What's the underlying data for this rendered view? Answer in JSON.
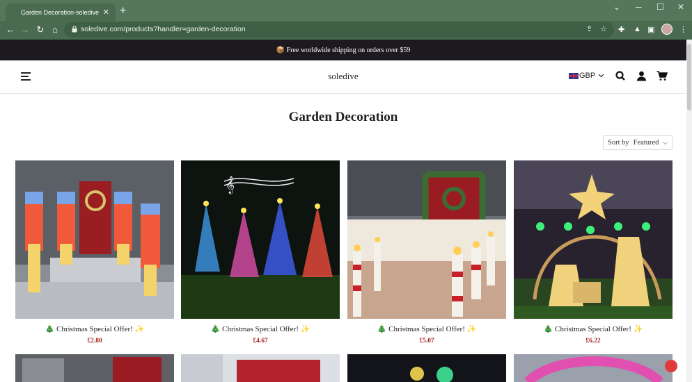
{
  "browser": {
    "tab_title": "Garden Decoration-soledive",
    "tab_close": "✕",
    "new_tab": "+",
    "url": "soledive.com/products?handler=garden-decoration"
  },
  "announcement": "📦 Free worldwide shipping on orders over $59",
  "header": {
    "brand": "soledive",
    "currency": "GBP"
  },
  "page": {
    "title": "Garden Decoration",
    "sort_label": "Sort by",
    "sort_value": "Featured"
  },
  "products": [
    {
      "title": "🎄 Christmas Special Offer! ✨",
      "price": "£2.80"
    },
    {
      "title": "🎄 Christmas Special Offer! ✨",
      "price": "£4.67"
    },
    {
      "title": "🎄 Christmas Special Offer! ✨",
      "price": "£5.07"
    },
    {
      "title": "🎄 Christmas Special Offer! ✨",
      "price": "£6.22"
    }
  ],
  "colors": {
    "browser_frame": "#56775b",
    "announcement_bg": "#1d1a1f",
    "price": "#a1221f"
  }
}
